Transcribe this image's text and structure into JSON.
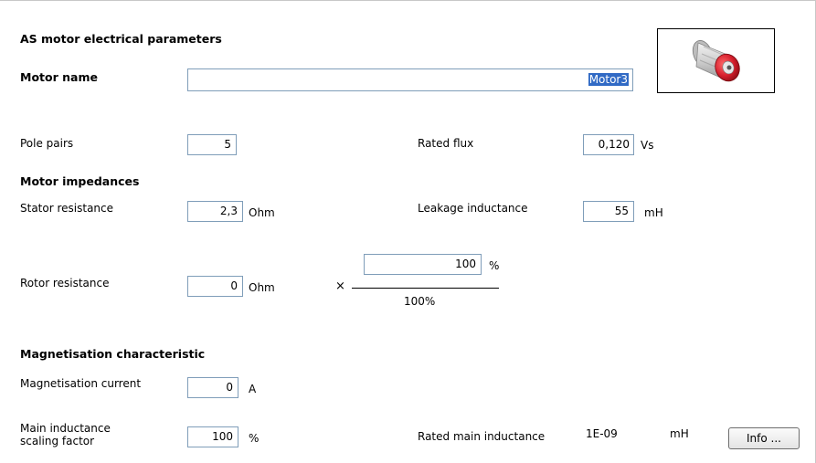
{
  "title": "AS motor electrical parameters",
  "motor_name": {
    "label": "Motor name",
    "value": "Motor3"
  },
  "pole_pairs": {
    "label": "Pole pairs",
    "value": "5"
  },
  "rated_flux": {
    "label": "Rated flux",
    "value": "0,120",
    "unit": "Vs"
  },
  "motor_impedances": {
    "heading": "Motor impedances",
    "stator_resistance": {
      "label": "Stator resistance",
      "value": "2,3",
      "unit": "Ohm"
    },
    "leakage_inductance": {
      "label": "Leakage inductance",
      "value": "55",
      "unit": "mH"
    },
    "rotor_resistance": {
      "label": "Rotor resistance",
      "value": "0",
      "unit": "Ohm",
      "times_sign": "×",
      "percent_value": "100",
      "percent_unit": "%",
      "denominator": "100%"
    }
  },
  "magnetisation": {
    "heading": "Magnetisation characteristic",
    "current": {
      "label": "Magnetisation current",
      "value": "0",
      "unit": "A"
    },
    "main_inductance_scaling": {
      "label_line1": "Main inductance",
      "label_line2": "scaling factor",
      "value": "100",
      "unit": "%"
    },
    "rated_main_inductance": {
      "label": "Rated main inductance",
      "value": "1E-09",
      "unit": "mH"
    },
    "info_button": "Info ..."
  },
  "image": {
    "icon": "motor-icon",
    "colors": {
      "body": "#d8d8d8",
      "end_cap": "#d61f2d"
    }
  }
}
